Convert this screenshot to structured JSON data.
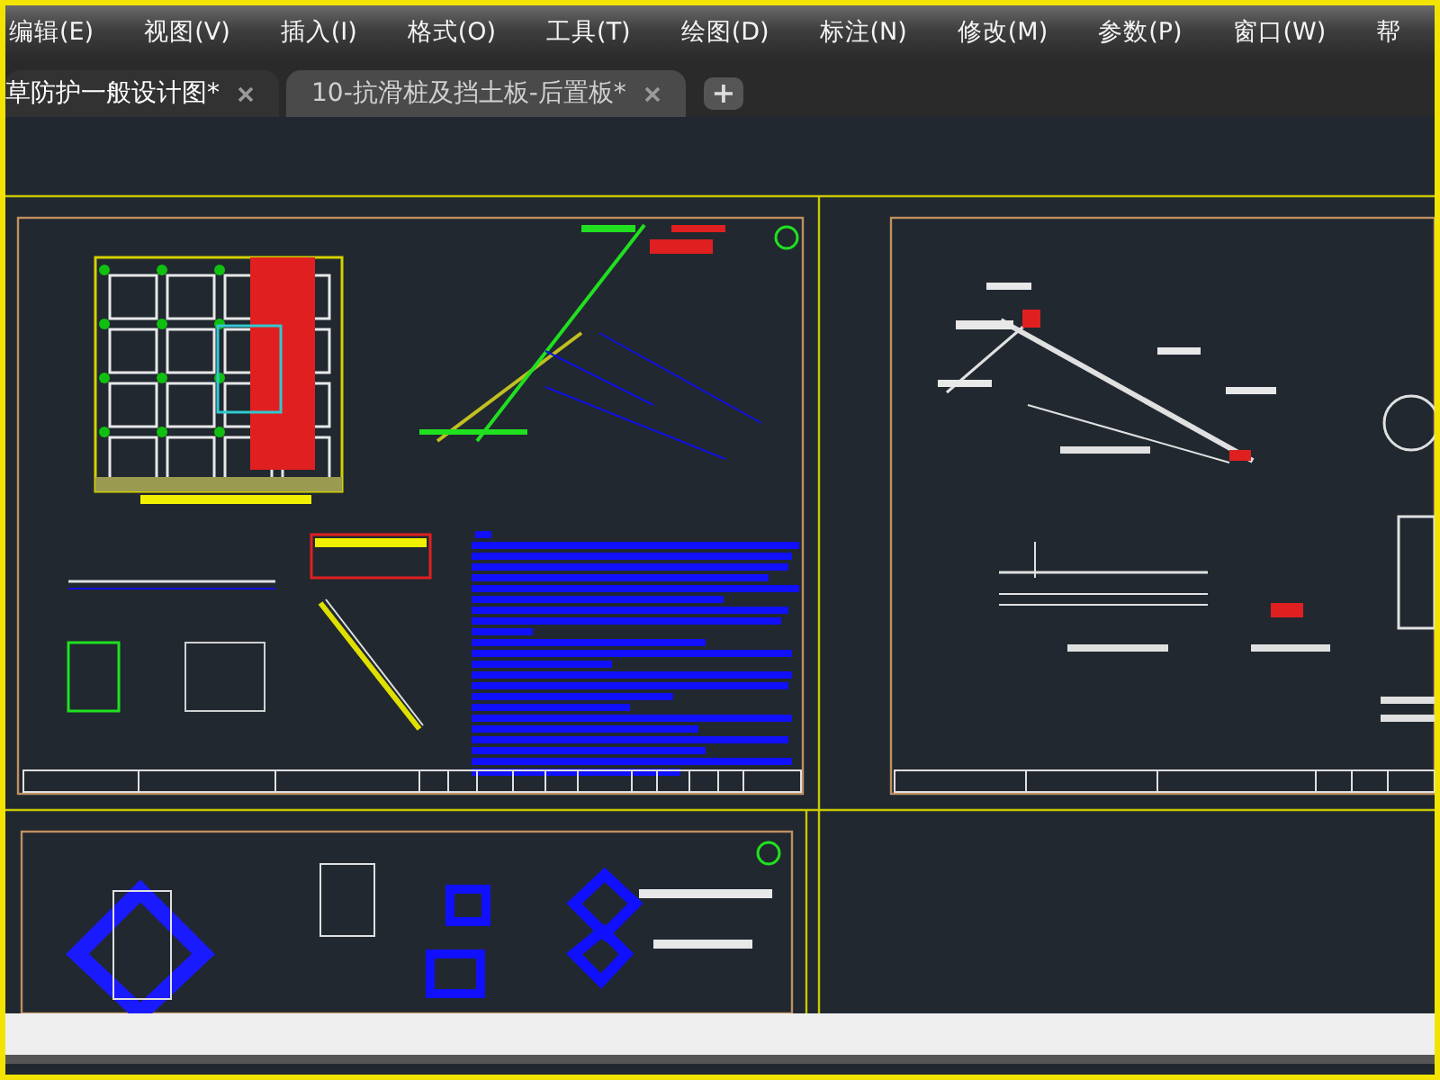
{
  "menu_bar": {
    "items": [
      "编辑(E)",
      "视图(V)",
      "插入(I)",
      "格式(O)",
      "工具(T)",
      "绘图(D)",
      "标注(N)",
      "修改(M)",
      "参数(P)",
      "窗口(W)",
      "帮"
    ]
  },
  "tabs": [
    {
      "label": "草防护一般设计图*",
      "selected": true,
      "closable": true
    },
    {
      "label": "10-抗滑桩及挡土板-后置板*",
      "selected": false,
      "closable": true
    }
  ],
  "new_tab": {
    "label": "+"
  }
}
